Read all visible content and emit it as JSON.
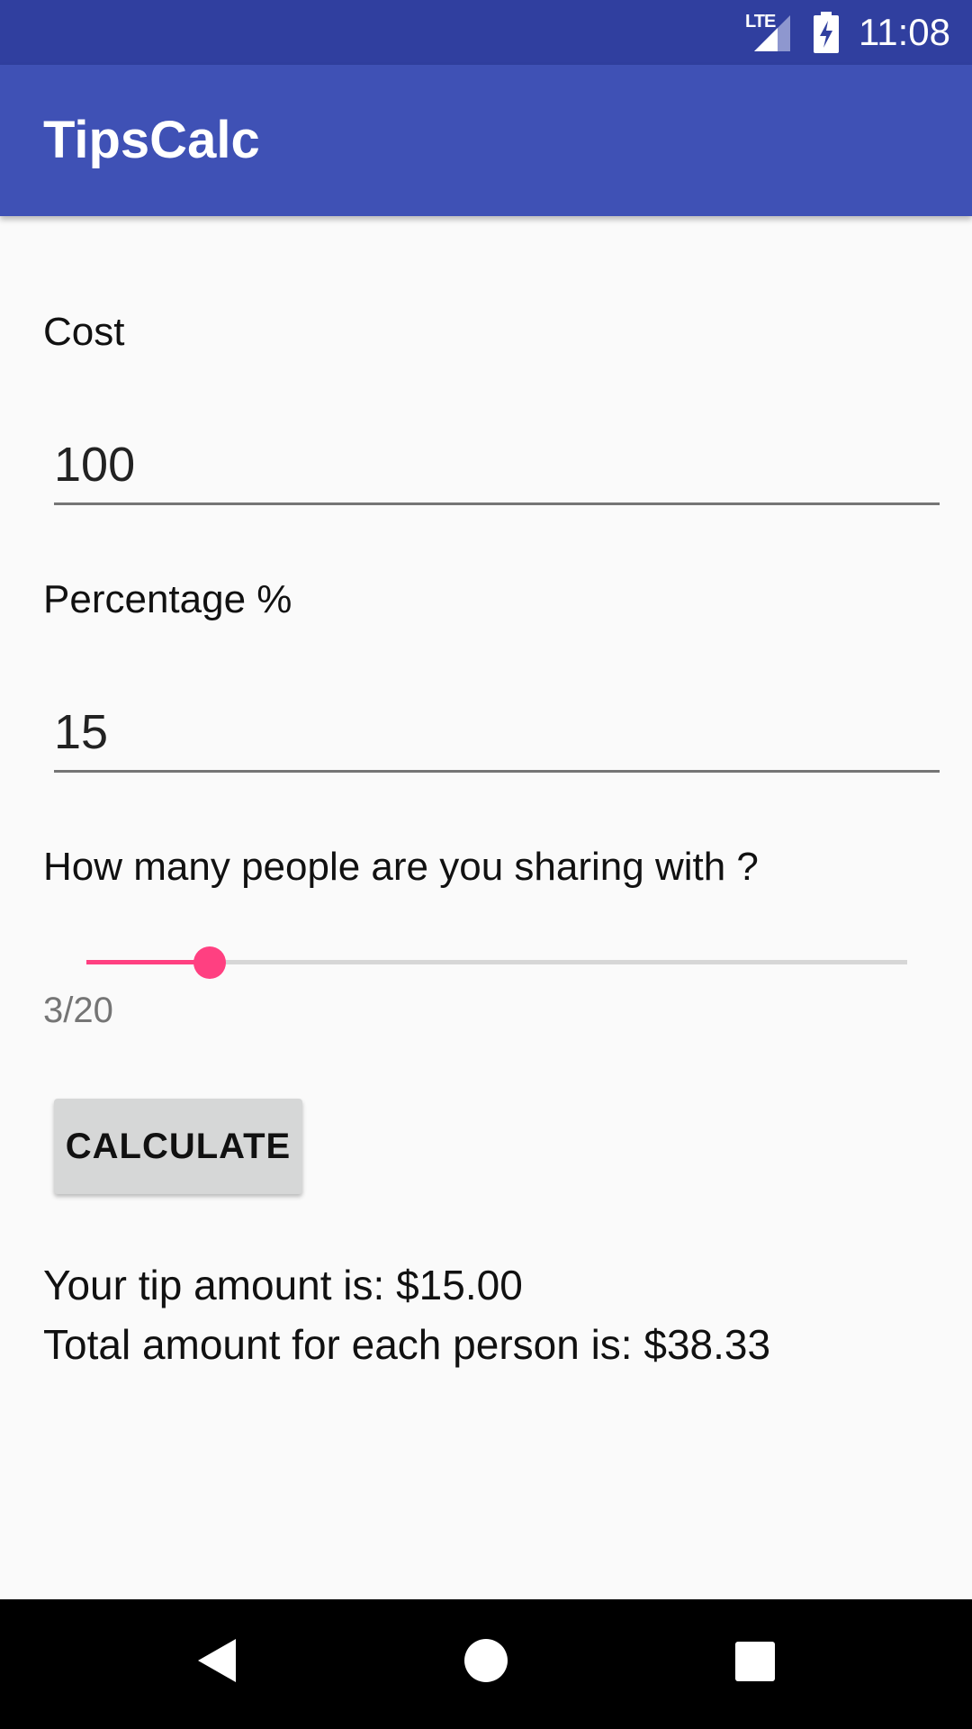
{
  "status": {
    "network": "LTE",
    "time": "11:08"
  },
  "app": {
    "title": "TipsCalc"
  },
  "form": {
    "cost_label": "Cost",
    "cost_value": "100",
    "percentage_label": "Percentage %",
    "percentage_value": "15",
    "sharing_label": "How many people are you sharing with ?",
    "slider": {
      "value": 3,
      "max": 20,
      "display": "3/20"
    },
    "calculate_label": "CALCULATE"
  },
  "results": {
    "tip_text": "Your tip amount is: $15.00",
    "total_text": "Total amount for each person is: $38.33"
  },
  "nav": {
    "back_icon": "back-icon",
    "home_icon": "home-icon",
    "recents_icon": "recents-icon"
  },
  "colors": {
    "status_bar": "#303f9f",
    "app_bar": "#3f51b5",
    "accent": "#ff4081"
  }
}
